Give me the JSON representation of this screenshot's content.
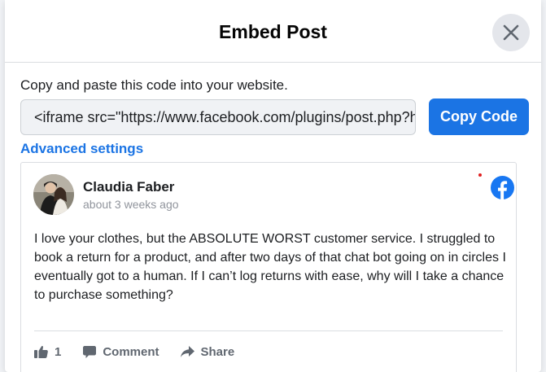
{
  "dialog": {
    "title": "Embed Post",
    "close_icon": "close-icon"
  },
  "embed": {
    "instructions": "Copy and paste this code into your website.",
    "code_value": "<iframe src=\"https://www.facebook.com/plugins/post.php?href=",
    "copy_button_label": "Copy Code",
    "advanced_settings_label": "Advanced settings"
  },
  "post": {
    "author": "Claudia Faber",
    "timestamp": "about 3 weeks ago",
    "text": "I love your clothes, but the ABSOLUTE WORST customer service. I struggled to book a return for a product, and after two days of that chat bot going on in circles I eventually got to a human. If I can’t log returns with ease, why will I take a chance to purchase something?",
    "like_count": "1",
    "comment_label": "Comment",
    "share_label": "Share",
    "icons": [
      "facebook-logo-icon",
      "like-icon",
      "comment-icon",
      "share-icon"
    ]
  },
  "colors": {
    "accent": "#1b74e4",
    "facebook_blue": "#1877f2",
    "muted_text": "#606770"
  }
}
